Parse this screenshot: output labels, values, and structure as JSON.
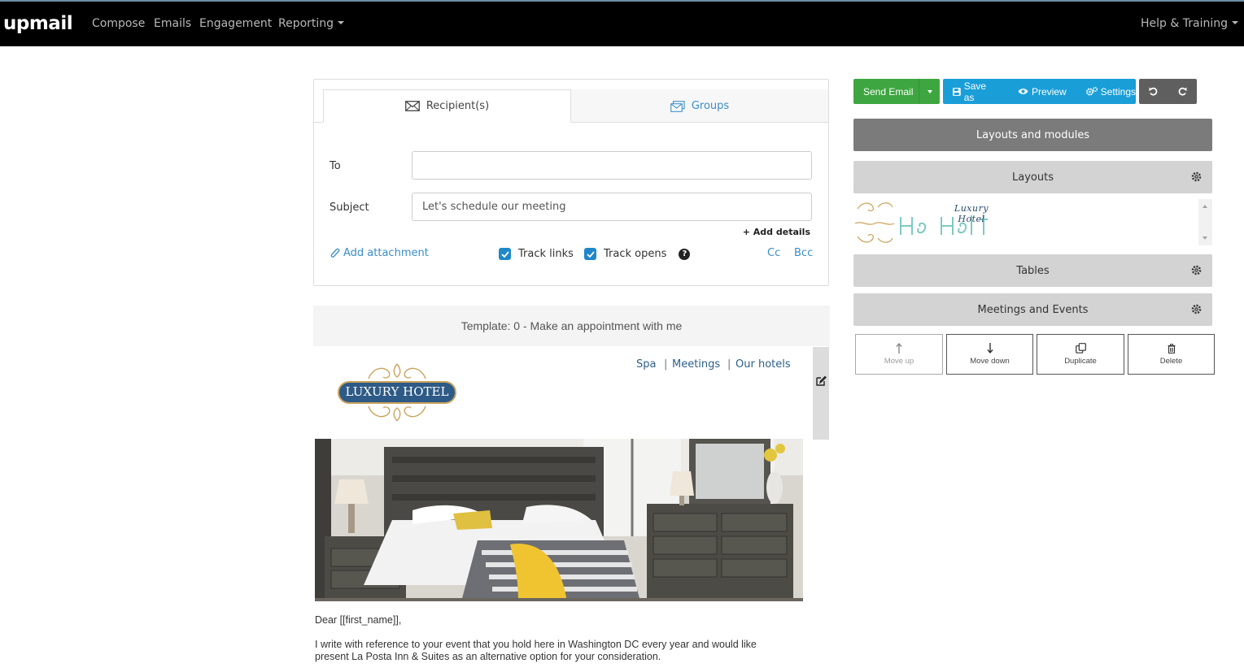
{
  "app": {
    "logo": "upmail"
  },
  "nav": {
    "compose": "Compose",
    "emails": "Emails",
    "engagement": "Engagement",
    "reporting": "Reporting",
    "help": "Help & Training"
  },
  "recipients": {
    "tab_recipients": "Recipient(s)",
    "tab_groups": "Groups",
    "to_label": "To",
    "to_value": "",
    "subject_label": "Subject",
    "subject_value": "Let's schedule our meeting",
    "add_details": "+ Add details",
    "add_attachment": "Add attachment",
    "track_links": "Track links",
    "track_links_checked": true,
    "track_opens": "Track opens",
    "track_opens_checked": true,
    "cc": "Cc",
    "bcc": "Bcc"
  },
  "template": {
    "label": "Template: 0 - Make an appointment with me"
  },
  "email": {
    "logo_text": "LUXURY HOTEL",
    "nav_spa": "Spa",
    "nav_meetings": "Meetings",
    "nav_hotels": "Our hotels",
    "sep": "|",
    "greeting": "Dear [[first_name]],",
    "paragraph_line1": "I write with reference to your event that you hold here in Washington DC every year and would like",
    "paragraph_line2": "present La Posta Inn & Suites as an alternative option for your consideration."
  },
  "toolbar": {
    "send_email": "Send Email",
    "save_as": "Save as",
    "preview": "Preview",
    "settings": "Settings"
  },
  "modules": {
    "title": "Layouts and modules",
    "layouts": "Layouts",
    "layouts_thumb_text": "Luxury Hotel",
    "tables": "Tables",
    "meetings_events": "Meetings and Events"
  },
  "actions": {
    "move_up": "Move up",
    "move_down": "Move down",
    "duplicate": "Duplicate",
    "delete": "Delete"
  },
  "colors": {
    "nav_bg": "#000000",
    "send_green": "#3ea640",
    "toolbar_blue": "#1a9ed8",
    "link_blue": "#3a8dc9",
    "checkbox_blue": "#1e88c9"
  }
}
